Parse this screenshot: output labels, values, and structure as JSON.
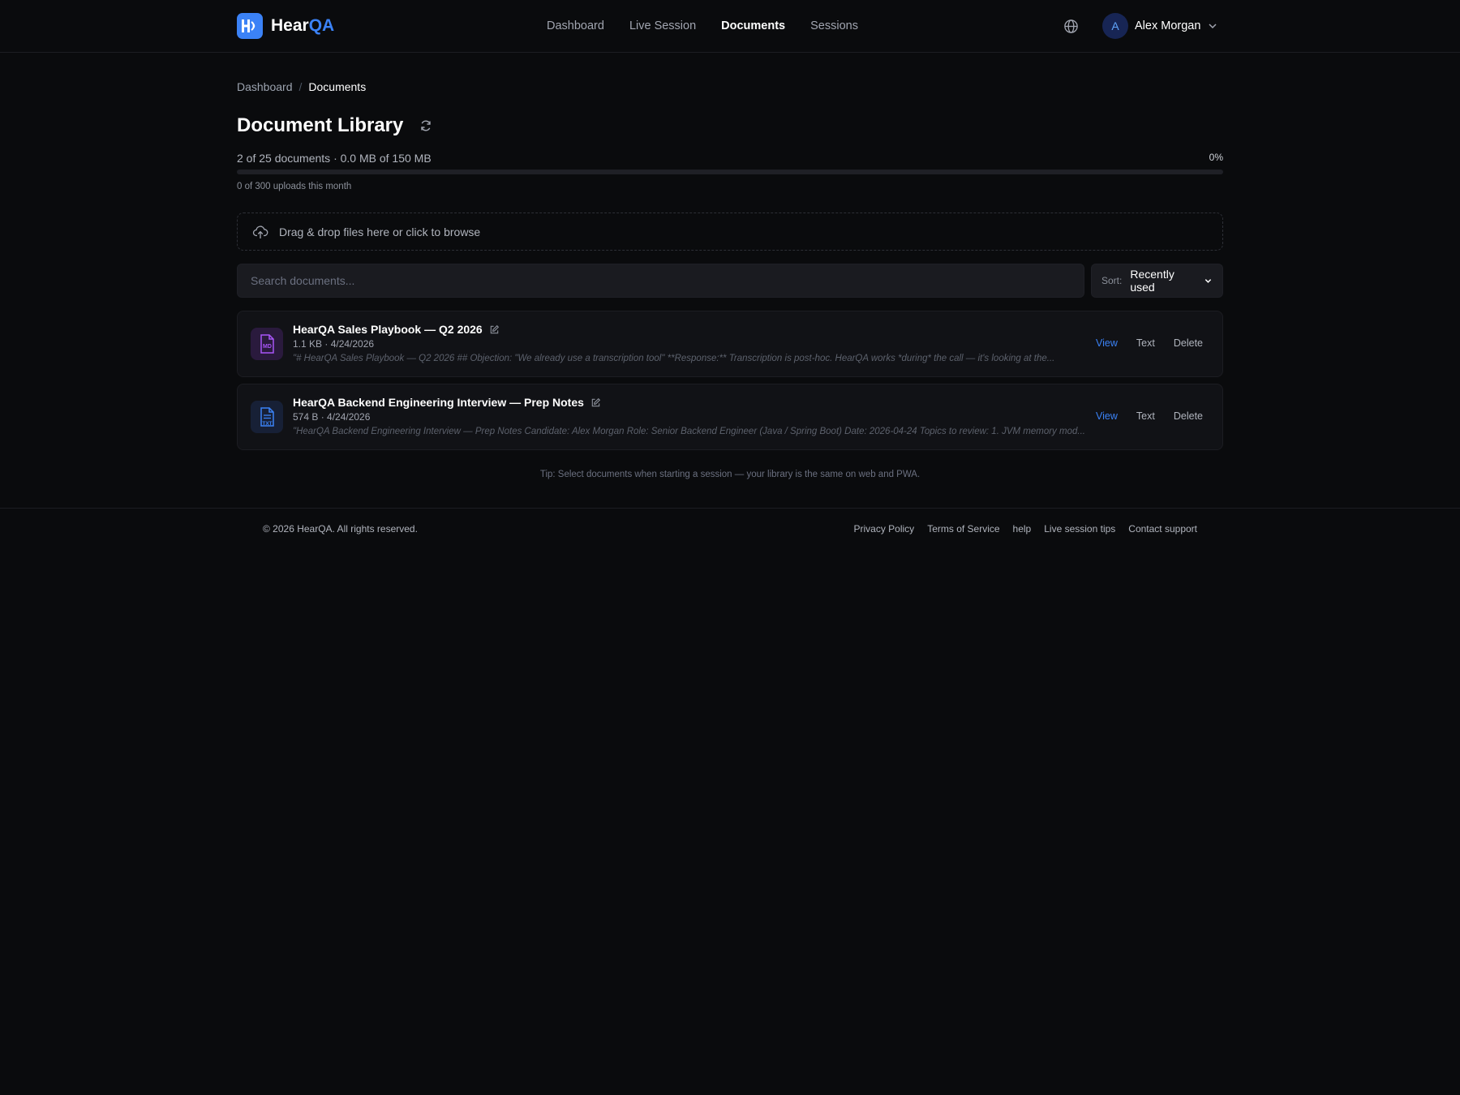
{
  "brand": {
    "name_part1": "Hear",
    "name_part2": "QA"
  },
  "nav": [
    {
      "label": "Dashboard",
      "active": false
    },
    {
      "label": "Live Session",
      "active": false
    },
    {
      "label": "Documents",
      "active": true
    },
    {
      "label": "Sessions",
      "active": false
    }
  ],
  "user": {
    "initial": "A",
    "name": "Alex Morgan"
  },
  "breadcrumb": {
    "parent": "Dashboard",
    "separator": "/",
    "current": "Documents"
  },
  "page": {
    "title": "Document Library"
  },
  "usage": {
    "summary": "2 of 25 documents · 0.0 MB of 150 MB",
    "percent_label": "0%",
    "percent": 0,
    "uploads": "0 of 300 uploads this month"
  },
  "dropzone": {
    "text": "Drag & drop files here or click to browse"
  },
  "search": {
    "placeholder": "Search documents...",
    "value": ""
  },
  "sort": {
    "label": "Sort:",
    "value": "Recently used"
  },
  "documents": [
    {
      "title": "HearQA Sales Playbook — Q2 2026",
      "meta": "1.1 KB · 4/24/2026",
      "snippet": "\"# HearQA Sales Playbook — Q2 2026 ## Objection: \"We already use a transcription tool\" **Response:** Transcription is post-hoc. HearQA works *during* the call — it's looking at the...",
      "file_type": "MD",
      "icon_color": "#a855f7",
      "icon_bg": "#2a1a3d"
    },
    {
      "title": "HearQA Backend Engineering Interview — Prep Notes",
      "meta": "574 B · 4/24/2026",
      "snippet": "\"HearQA Backend Engineering Interview — Prep Notes Candidate: Alex Morgan Role: Senior Backend Engineer (Java / Spring Boot) Date: 2026-04-24 Topics to review: 1. JVM memory mod...",
      "file_type": "TXT",
      "icon_color": "#3b82f6",
      "icon_bg": "#172036"
    }
  ],
  "actions": {
    "view": "View",
    "text": "Text",
    "delete": "Delete"
  },
  "tip": "Tip: Select documents when starting a session — your library is the same on web and PWA.",
  "footer": {
    "copyright": "© 2026 HearQA. All rights reserved.",
    "links": [
      "Privacy Policy",
      "Terms of Service",
      "help",
      "Live session tips",
      "Contact support"
    ]
  },
  "colors": {
    "accent": "#3b82f6",
    "background": "#0a0b0d",
    "card": "#111216"
  }
}
